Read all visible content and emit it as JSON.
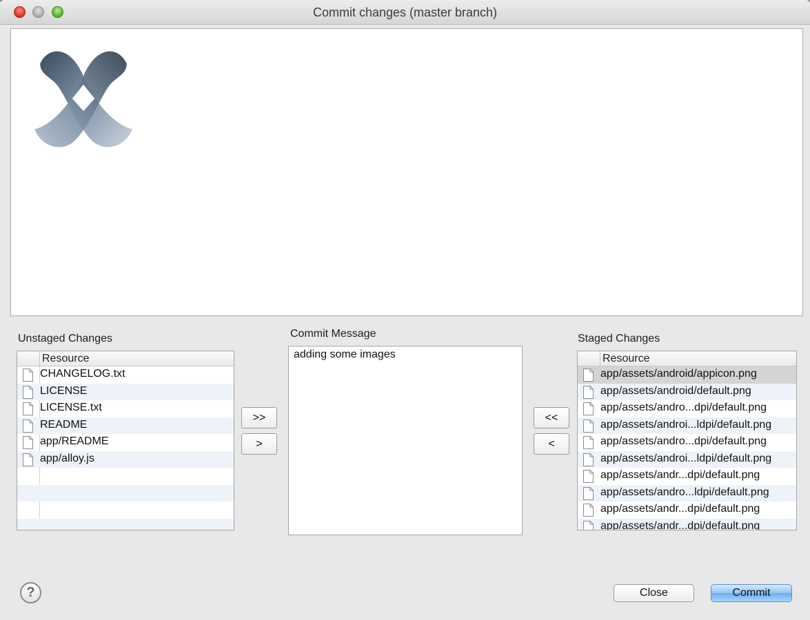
{
  "window": {
    "title": "Commit changes (master branch)"
  },
  "unstaged": {
    "label": "Unstaged Changes",
    "column": "Resource",
    "files": [
      "CHANGELOG.txt",
      "LICENSE",
      "LICENSE.txt",
      "README",
      "app/README",
      "app/alloy.js"
    ]
  },
  "message": {
    "label": "Commit Message",
    "value": "adding some images"
  },
  "staged": {
    "label": "Staged Changes",
    "column": "Resource",
    "selected_index": 0,
    "files": [
      "app/assets/android/appicon.png",
      "app/assets/android/default.png",
      "app/assets/andro...dpi/default.png",
      "app/assets/androi...ldpi/default.png",
      "app/assets/andro...dpi/default.png",
      "app/assets/androi...ldpi/default.png",
      "app/assets/andr...dpi/default.png",
      "app/assets/andro...ldpi/default.png",
      "app/assets/andr...dpi/default.png",
      "app/assets/andr...dpi/default.png"
    ]
  },
  "buttons": {
    "stage_all": ">>",
    "stage_selected": ">",
    "unstage_all": "<<",
    "unstage_selected": "<",
    "close": "Close",
    "commit": "Commit",
    "help": "?"
  }
}
